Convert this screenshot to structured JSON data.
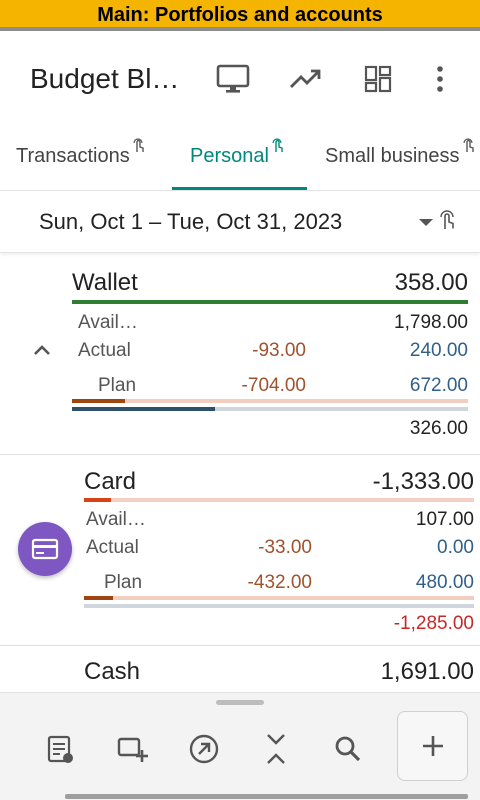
{
  "banner": "Main: Portfolios and accounts",
  "app": {
    "title": "Budget Bl…"
  },
  "toolbar_icons": [
    "monitor-icon",
    "trending-up-icon",
    "dashboard-icon",
    "more-vert-icon"
  ],
  "tabs": [
    {
      "label": "Transactions",
      "active": false
    },
    {
      "label": "Personal",
      "active": true
    },
    {
      "label": "Small business",
      "active": false
    }
  ],
  "period": {
    "label": "Sun, Oct 1 – Tue, Oct 31, 2023"
  },
  "accounts": [
    {
      "name": "Wallet",
      "total": "358.00",
      "available_label": "Avail…",
      "available_value": "1,798.00",
      "actual_label": "Actual",
      "actual_mid": "-93.00",
      "actual_right": "240.00",
      "plan_label": "Plan",
      "plan_mid": "-704.00",
      "plan_right": "672.00",
      "footer": "326.00",
      "plan_progress": 0.135,
      "actual_progress": 0.36
    },
    {
      "name": "Card",
      "total": "-1,333.00",
      "available_label": "Avail…",
      "available_value": "107.00",
      "actual_label": "Actual",
      "actual_mid": "-33.00",
      "actual_right": "0.00",
      "plan_label": "Plan",
      "plan_mid": "-432.00",
      "plan_right": "480.00",
      "footer": "-1,285.00",
      "total_progress": 0.07,
      "plan_progress": 0.075,
      "actual_progress": 0.0
    },
    {
      "name": "Cash",
      "total": "1,691.00"
    }
  ],
  "bottom_icons": [
    "transaction-list-icon",
    "add-account-icon",
    "transfer-icon",
    "collapse-icon",
    "search-icon",
    "add-icon"
  ],
  "colors": {
    "banner": "#f5b400",
    "accent": "#00897b",
    "wallet_line": "#2e7d32",
    "negative": "#c62828",
    "plan": "#a0522d",
    "actual": "#2f5f8a",
    "card_fab": "#7e57c2"
  }
}
